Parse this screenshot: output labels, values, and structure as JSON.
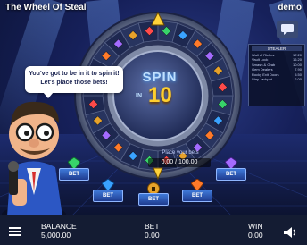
{
  "header": {
    "title": "The Wheel Of Steal",
    "mode": "demo"
  },
  "speech_bubble": {
    "line1": "You've got to be in it to spin it!",
    "line2": "Let's place those bets!"
  },
  "wheel": {
    "spin_word": "SPIN",
    "in_word": "IN",
    "countdown": "10"
  },
  "side_panel": {
    "header": "STEALER",
    "rows": [
      {
        "label": "Wall of Riches",
        "value": "17.20"
      },
      {
        "label": "Vault Lock",
        "value": "16.20"
      },
      {
        "label": "Smash & Grab",
        "value": "10.00"
      },
      {
        "label": "Gem Dealers",
        "value": "7.90"
      },
      {
        "label": "Rocky Exit Doors",
        "value": "5.50"
      },
      {
        "label": "Stay Jackpot",
        "value": "2.00"
      }
    ]
  },
  "betting": {
    "prompt": "Place your bets",
    "amount": "0.00 / 100.00",
    "spots": [
      {
        "label": "BET",
        "gem": "green"
      },
      {
        "label": "BET",
        "gem": "blue"
      },
      {
        "label": "BET",
        "gem": "lock"
      },
      {
        "label": "BET",
        "gem": "orange"
      },
      {
        "label": "BET",
        "gem": "purple"
      }
    ]
  },
  "footer": {
    "balance_label": "BALANCE",
    "balance_value": "5,000.00",
    "bet_label": "BET",
    "bet_value": "0.00",
    "win_label": "WIN",
    "win_value": "0.00"
  },
  "colors": {
    "accent": "#3f7ad9",
    "countdown": "#ffcf2e",
    "background": "#16205a"
  }
}
